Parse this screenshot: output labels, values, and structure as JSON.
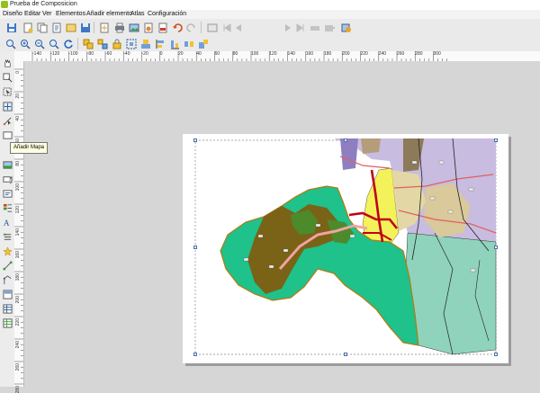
{
  "window": {
    "title": "Prueba de Composicion"
  },
  "menu": [
    "Diseño",
    "Editar",
    "Ver",
    "Elementos",
    "Añadir elemento",
    "Atlas",
    "Configuración"
  ],
  "toolbar": {
    "page_value": "1",
    "icons": [
      "save-icon",
      "new-composer-icon",
      "duplicate-composer-icon",
      "composer-manager-icon",
      "save-template-icon",
      "open-template-icon",
      "print-icon",
      "export-image-icon",
      "export-svg-icon",
      "export-pdf-icon",
      "undo-icon",
      "redo-icon",
      "atlas-preview-icon",
      "first-feature-icon",
      "previous-feature-icon",
      "next-feature-icon",
      "last-feature-icon",
      "print-atlas-icon",
      "export-atlas-icon",
      "atlas-settings-icon"
    ]
  },
  "toolbar2": {
    "icons": [
      "zoom-full-icon",
      "zoom-in-icon",
      "zoom-out-icon",
      "zoom-actual-icon",
      "refresh-icon",
      "group-icon",
      "ungroup-icon",
      "lock-icon",
      "unlock-icon",
      "raise-icon",
      "align-left-icon",
      "align-center-icon",
      "distribute-icon",
      "resize-icon"
    ]
  },
  "ruler": {
    "h_labels": [
      "-140",
      "-120",
      "-100",
      "-80",
      "-60",
      "-40",
      "-20",
      "0",
      "20",
      "40",
      "60",
      "80",
      "100",
      "120",
      "140",
      "160",
      "180",
      "200",
      "220",
      "240",
      "260",
      "280",
      "300"
    ],
    "v_labels": [
      "0",
      "20",
      "40",
      "60",
      "80",
      "100",
      "120",
      "140",
      "160",
      "180",
      "200",
      "220",
      "240",
      "260",
      "280"
    ]
  },
  "left_tools": [
    "pan-icon",
    "zoom-tool-icon",
    "select-move-icon",
    "move-content-icon",
    "edit-nodes-icon",
    "add-map-icon",
    "add-image-icon",
    "add-3d-map-icon",
    "add-label-icon",
    "add-legend-icon",
    "add-scalebar-icon",
    "add-north-arrow-icon",
    "add-shape-icon",
    "add-node-icon",
    "add-arrow-icon",
    "add-html-icon",
    "add-table-icon",
    "add-attribute-table-icon"
  ],
  "tooltip": "Añadir Mapa",
  "colors": {
    "green": "#1ec28a",
    "olive": "#7a6316",
    "yellow": "#f4f25a",
    "lavender": "#c8bce0",
    "gray_teal": "#8fd3bd",
    "road_red": "#c0001a"
  }
}
